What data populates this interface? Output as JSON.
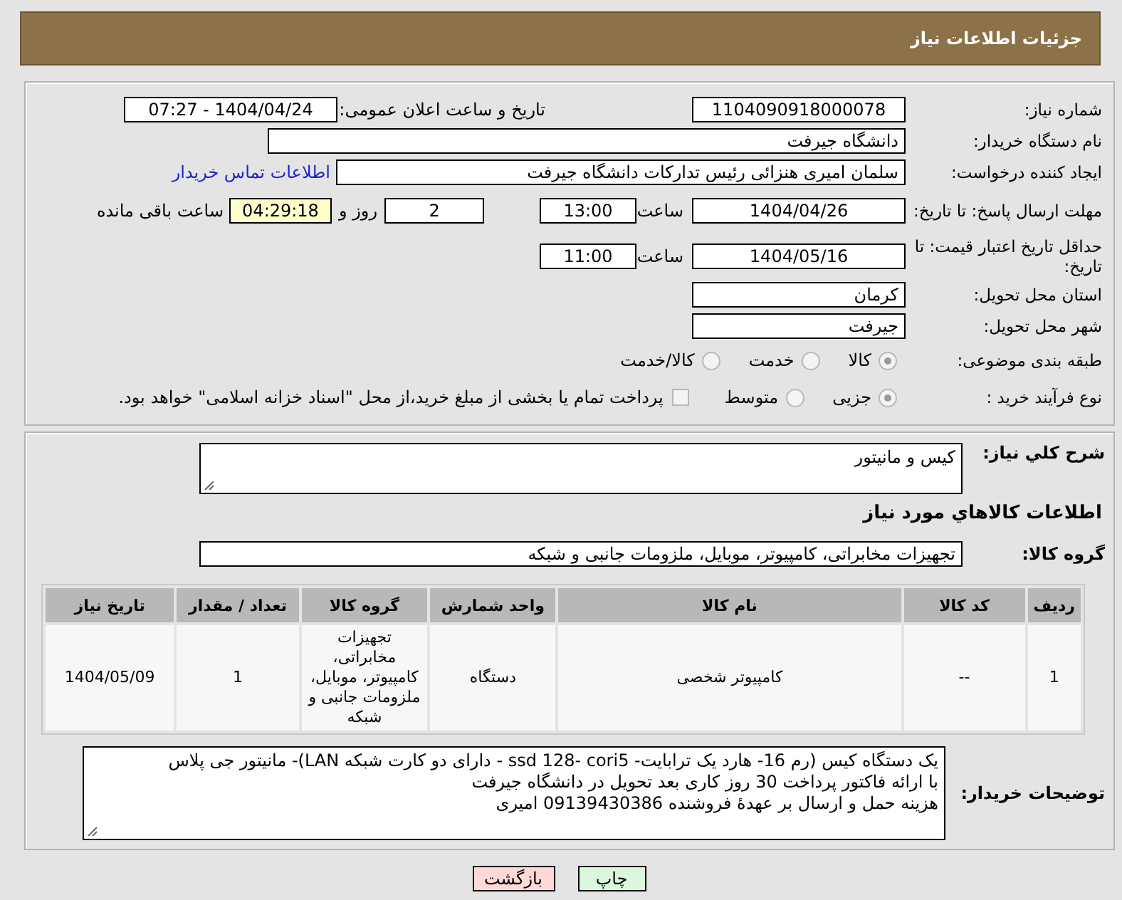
{
  "header": {
    "title": "جزئیات اطلاعات نیاز"
  },
  "need_number": {
    "label": "شماره نیاز:",
    "value": "1104090918000078"
  },
  "announce": {
    "label": "تاریخ و ساعت اعلان عمومی:",
    "value": "1404/04/24 - 07:27"
  },
  "buyer": {
    "label": "نام دستگاه خریدار:",
    "value": "دانشگاه جیرفت"
  },
  "requester": {
    "label": "ایجاد کننده درخواست:",
    "value": "سلمان امیری هنزائی رئیس تدارکات دانشگاه جیرفت",
    "link": "اطلاعات تماس خریدار"
  },
  "deadline": {
    "label": "مهلت ارسال پاسخ: تا تاریخ:",
    "date": "1404/04/26",
    "time_label": "ساعت",
    "time": "13:00",
    "days": "2",
    "days_label": "روز و",
    "remaining": "04:29:18",
    "remaining_label": "ساعت باقی مانده"
  },
  "price_validity": {
    "label": "حداقل تاریخ اعتبار قیمت: تا تاریخ:",
    "date": "1404/05/16",
    "time_label": "ساعت",
    "time": "11:00"
  },
  "province": {
    "label": "استان محل تحویل:",
    "value": "کرمان"
  },
  "city": {
    "label": "شهر محل تحویل:",
    "value": "جیرفت"
  },
  "category": {
    "label": "طبقه بندی موضوعی:",
    "options": [
      {
        "label": "کالا",
        "selected": true
      },
      {
        "label": "خدمت",
        "selected": false
      },
      {
        "label": "کالا/خدمت",
        "selected": false
      }
    ]
  },
  "process": {
    "label": "نوع فرآیند خرید :",
    "options": [
      {
        "label": "جزیی",
        "selected": true
      },
      {
        "label": "متوسط",
        "selected": false
      }
    ],
    "treasury": {
      "checked": false,
      "label": "پرداخت تمام یا بخشی از مبلغ خرید،از محل \"اسناد خزانه اسلامی\" خواهد بود."
    }
  },
  "description": {
    "label": "شرح كلي نياز:",
    "value": "کیس و مانیتور"
  },
  "goods_heading": "اطلاعات كالاهاي مورد نياز",
  "goods_group": {
    "label": "گروه کالا:",
    "value": "تجهیزات مخابراتی، کامپیوتر، موبایل، ملزومات جانبی و شبکه"
  },
  "table": {
    "columns": [
      "ردیف",
      "کد کالا",
      "نام کالا",
      "واحد شمارش",
      "گروه کالا",
      "تعداد / مقدار",
      "تاریخ نیاز"
    ],
    "rows": [
      [
        "1",
        "--",
        "کامپیوتر شخصی",
        "دستگاه",
        "تجهیزات مخابراتی، کامپیوتر، موبایل، ملزومات جانبی و شبکه",
        "1",
        "1404/05/09"
      ]
    ]
  },
  "buyer_notes": {
    "label": "توضیحات خریدار:",
    "lines": [
      "یک دستگاه کیس (رم 16- هارد یک ترابایت- ssd 128- cori5 - دارای دو کارت شبکه LAN)- مانیتور جی پلاس",
      "با ارائه فاکتور پرداخت 30 روز کاری بعد تحویل در دانشگاه جیرفت",
      "هزینه حمل و ارسال بر عهدهٔ فروشنده 09139430386 امیری"
    ]
  },
  "buttons": [
    {
      "label": "چاپ",
      "kind": "print"
    },
    {
      "label": "بازگشت",
      "kind": "back"
    }
  ]
}
